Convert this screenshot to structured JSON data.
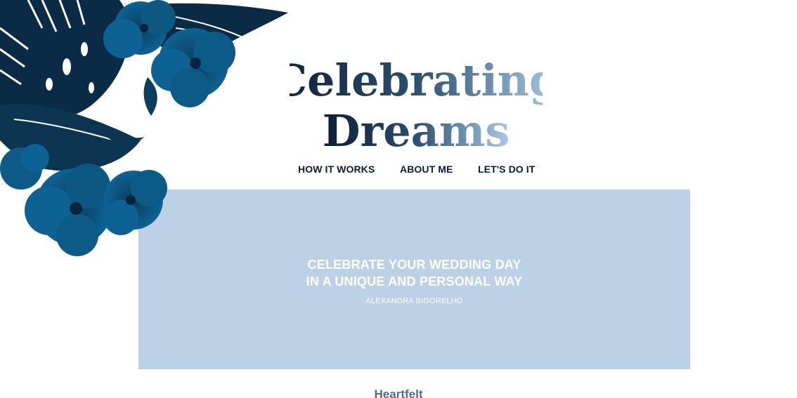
{
  "brand": {
    "line1": "Celebrating",
    "line2": "Dreams"
  },
  "nav": {
    "items": [
      {
        "label": "HOW IT WORKS"
      },
      {
        "label": "ABOUT ME"
      },
      {
        "label": "LET'S DO IT"
      }
    ]
  },
  "hero": {
    "title_line1": "CELEBRATE YOUR WEDDING DAY",
    "title_line2": "IN A UNIQUE AND PERSONAL WAY",
    "author": "ALEXANDRA SIGORELHO"
  },
  "section": {
    "heading": "Heartfelt"
  },
  "decor": {
    "floral_icon": "tropical-flowers-illustration"
  },
  "colors": {
    "navy": "#0b1d33",
    "floral_blue": "#0b5b86",
    "hero_bg": "#bdd1e6",
    "light_blue": "#a9cbe6",
    "heading_blue": "#4d6f8f"
  }
}
